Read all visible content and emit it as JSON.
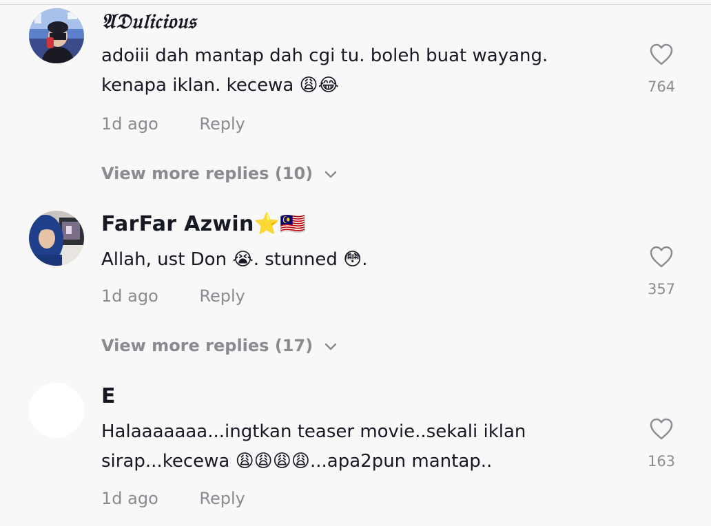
{
  "comments": [
    {
      "author": "𝔄𝔇𝔲𝔩𝔦𝔠𝔦𝔬𝔲𝔰",
      "line1": "adoiii dah mantap dah cgi tu. boleh buat wayang.",
      "line2": "kenapa iklan. kecewa 😩😂",
      "time": "1d ago",
      "reply": "Reply",
      "likes": "764",
      "view_more": "View more replies (10)"
    },
    {
      "author": "FarFar Azwin⭐🇲🇾",
      "line1": "Allah, ust Don 😭. stunned 😳.",
      "time": "1d ago",
      "reply": "Reply",
      "likes": "357",
      "view_more": "View more replies (17)"
    },
    {
      "author": "E",
      "line1": "Halaaaaaaa...ingtkan teaser movie..sekali iklan",
      "line2": "sirap...kecewa 😩😩😩😩...apa2pun mantap..",
      "time": "1d ago",
      "reply": "Reply",
      "likes": "163"
    }
  ],
  "icons": {
    "like": "heart-outline-icon",
    "expand": "chevron-down-icon"
  },
  "colors": {
    "background": "#f8f8f8",
    "text": "#161823",
    "secondary": "#8a8b91"
  }
}
